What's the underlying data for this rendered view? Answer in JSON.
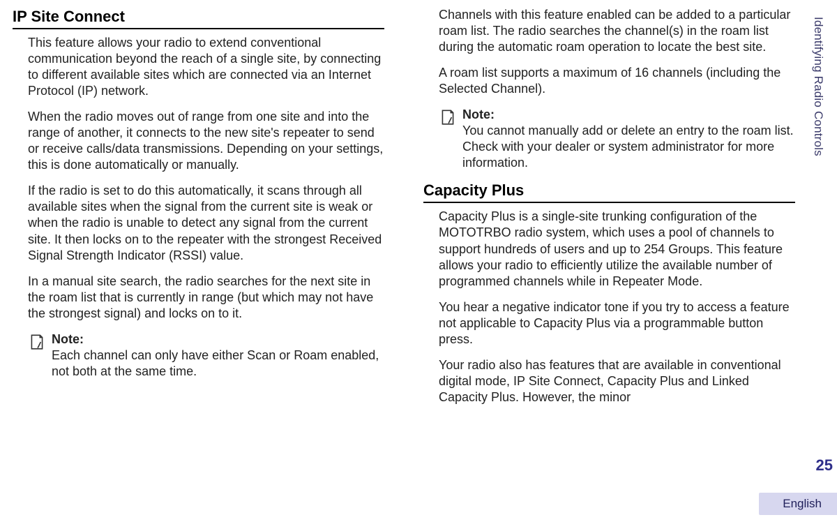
{
  "side": {
    "chapter": "Identifying Radio Controls",
    "pageNumber": "25",
    "language": "English"
  },
  "left": {
    "heading": "IP Site Connect",
    "p1": "This feature allows your radio to extend conventional communication beyond the reach of a single site, by connecting to different available sites which are connected via an Internet Protocol (IP) network.",
    "p2": "When the radio moves out of range from one site and into the range of another, it connects to the new site's repeater to send or receive calls/data transmissions. Depending on your settings, this is done automatically or manually.",
    "p3": "If the radio is set to do this automatically, it scans through all available sites when the signal from the current site is weak or when the radio is unable to detect any signal from the current site. It then locks on to the repeater with the strongest Received Signal Strength Indicator (RSSI) value.",
    "p4": "In a manual site search, the radio searches for the next site in the roam list that is currently in range (but which may not have the strongest signal) and locks on to it.",
    "note1": {
      "label": "Note:",
      "body": "Each channel can only have either Scan or Roam enabled, not both at the same time."
    }
  },
  "right": {
    "p1": "Channels with this feature enabled can be added to a particular roam list. The radio searches the channel(s) in the roam list during the automatic roam operation to locate the best site.",
    "p2": "A roam list supports a maximum of 16 channels (including the Selected Channel).",
    "note1": {
      "label": "Note:",
      "body": "You cannot manually add or delete an entry to the roam list. Check with your dealer or system administrator for more information."
    },
    "heading2": "Capacity Plus",
    "p3": "Capacity Plus is a single-site trunking configuration of the MOTOTRBO radio system, which uses a pool of channels to support hundreds of users and up to 254 Groups. This feature allows your radio to efficiently utilize the available number of programmed channels while in Repeater Mode.",
    "p4": "You hear a negative indicator tone if you try to access a feature not applicable to Capacity Plus via a programmable button press.",
    "p5": "Your radio also has features that are available in conventional digital mode, IP Site Connect, Capacity Plus and Linked Capacity Plus. However, the minor"
  }
}
